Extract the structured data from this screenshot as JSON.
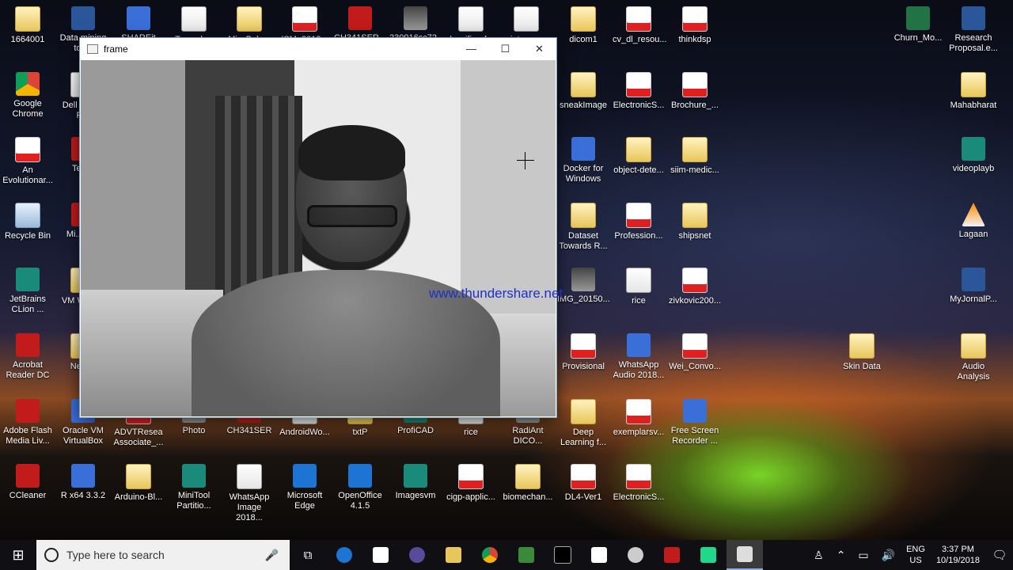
{
  "window": {
    "title": "frame",
    "minimize": "—",
    "maximize": "☐",
    "close": "✕"
  },
  "video": {
    "watermark": "www.thundershare.net"
  },
  "desktop_icons": [
    {
      "label": "1664001"
    },
    {
      "label": "Data mining tools"
    },
    {
      "label": "SHAREit"
    },
    {
      "label": "Texmaker"
    },
    {
      "label": "MissBalo..."
    },
    {
      "label": "ISM_2018..."
    },
    {
      "label": "CH341SER..."
    },
    {
      "label": "230916sc72..."
    },
    {
      "label": "classifier_fr..."
    },
    {
      "label": "interpr..."
    },
    {
      "label": "dicom1"
    },
    {
      "label": "cv_dl_resou..."
    },
    {
      "label": "thinkdsp"
    },
    {
      "label": "Churn_Mo..."
    },
    {
      "label": "Research Proposal.e..."
    },
    {
      "label": "Google Chrome"
    },
    {
      "label": "Dell ... and R..."
    },
    {
      "label": "sneakImage"
    },
    {
      "label": "ElectronicS..."
    },
    {
      "label": "Brochure_..."
    },
    {
      "label": "Mahabharat"
    },
    {
      "label": "An Evolutionar..."
    },
    {
      "label": "TeX..."
    },
    {
      "label": "Docker for Windows"
    },
    {
      "label": "object-dete..."
    },
    {
      "label": "siim-medic..."
    },
    {
      "label": "videoplayb"
    },
    {
      "label": "Recycle Bin"
    },
    {
      "label": "Mi... Fi..."
    },
    {
      "label": "Dataset Towards R..."
    },
    {
      "label": "Profession..."
    },
    {
      "label": "shipsnet"
    },
    {
      "label": "Lagaan"
    },
    {
      "label": "JetBrains CLion ..."
    },
    {
      "label": "VM Work..."
    },
    {
      "label": "IMG_20150..."
    },
    {
      "label": "rice"
    },
    {
      "label": "zivkovic200..."
    },
    {
      "label": "MyJornalP..."
    },
    {
      "label": "Acrobat Reader DC"
    },
    {
      "label": "Neur..."
    },
    {
      "label": "Provisional"
    },
    {
      "label": "WhatsApp Audio 2018..."
    },
    {
      "label": "Wei_Convo..."
    },
    {
      "label": "Skin Data"
    },
    {
      "label": "Audio Analysis"
    },
    {
      "label": "Adobe Flash Media Liv..."
    },
    {
      "label": "Oracle VM VirtualBox"
    },
    {
      "label": "ADVTResea Associate_..."
    },
    {
      "label": "Photo"
    },
    {
      "label": "CH341SER"
    },
    {
      "label": "AndroidWo..."
    },
    {
      "label": "txtP"
    },
    {
      "label": "ProfiCAD"
    },
    {
      "label": "rice"
    },
    {
      "label": "RadiAnt DICO..."
    },
    {
      "label": "Deep Learning f..."
    },
    {
      "label": "exemplarsv..."
    },
    {
      "label": "Free Screen Recorder ..."
    },
    {
      "label": "CCleaner"
    },
    {
      "label": "R x64 3.3.2"
    },
    {
      "label": "Arduino-Bl..."
    },
    {
      "label": "MiniTool Partitio..."
    },
    {
      "label": "WhatsApp Image 2018..."
    },
    {
      "label": "Microsoft Edge"
    },
    {
      "label": "OpenOffice 4.1.5"
    },
    {
      "label": "Imagesvm"
    },
    {
      "label": "cigp-applic..."
    },
    {
      "label": "biomechan..."
    },
    {
      "label": "DL4-Ver1"
    },
    {
      "label": "ElectronicS..."
    }
  ],
  "taskbar": {
    "start": "⊞",
    "search_placeholder": "Type here to search",
    "mic": "🎤",
    "task_view": "⧉",
    "lang_top": "ENG",
    "lang_bottom": "US",
    "time": "3:37 PM",
    "date": "10/19/2018",
    "notifications": "🗨"
  },
  "colors": {
    "taskbar": "#0f0f14",
    "watermark": "#1f2fc8"
  }
}
